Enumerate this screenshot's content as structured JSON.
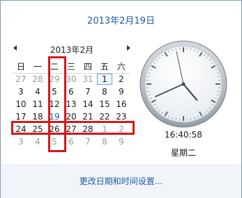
{
  "header": {
    "date_label": "2013年2月19日"
  },
  "calendar": {
    "month_title": "2013年2月",
    "weekdays": [
      "日",
      "一",
      "二",
      "三",
      "四",
      "五",
      "六"
    ],
    "weeks": [
      [
        {
          "d": "27",
          "o": true
        },
        {
          "d": "28",
          "o": true
        },
        {
          "d": "29",
          "o": true
        },
        {
          "d": "30",
          "o": true
        },
        {
          "d": "31",
          "o": true
        },
        {
          "d": "1",
          "s": true
        },
        {
          "d": "2"
        }
      ],
      [
        {
          "d": "3"
        },
        {
          "d": "4"
        },
        {
          "d": "5"
        },
        {
          "d": "6"
        },
        {
          "d": "7"
        },
        {
          "d": "8"
        },
        {
          "d": "9"
        }
      ],
      [
        {
          "d": "10"
        },
        {
          "d": "11"
        },
        {
          "d": "12"
        },
        {
          "d": "13"
        },
        {
          "d": "14"
        },
        {
          "d": "15"
        },
        {
          "d": "16"
        }
      ],
      [
        {
          "d": "17"
        },
        {
          "d": "18"
        },
        {
          "d": "19",
          "t": true
        },
        {
          "d": "20"
        },
        {
          "d": "21"
        },
        {
          "d": "22"
        },
        {
          "d": "23"
        }
      ],
      [
        {
          "d": "24"
        },
        {
          "d": "25"
        },
        {
          "d": "26"
        },
        {
          "d": "27"
        },
        {
          "d": "28"
        },
        {
          "d": "1",
          "o": true
        },
        {
          "d": "2",
          "o": true
        }
      ],
      [
        {
          "d": "3",
          "o": true
        },
        {
          "d": "4",
          "o": true
        },
        {
          "d": "5",
          "o": true
        },
        {
          "d": "6",
          "o": true
        },
        {
          "d": "7",
          "o": true
        },
        {
          "d": "8",
          "o": true
        },
        {
          "d": "9",
          "o": true
        }
      ]
    ],
    "highlighted_column": "二",
    "highlighted_week": 5
  },
  "clock": {
    "time": "16:40:58",
    "weekday": "星期二"
  },
  "footer": {
    "change_settings_link": "更改日期和时间设置..."
  },
  "colors": {
    "accent": "#1e5aa8",
    "highlight_box": "#d8161b",
    "other_month": "#9a9a9a"
  }
}
